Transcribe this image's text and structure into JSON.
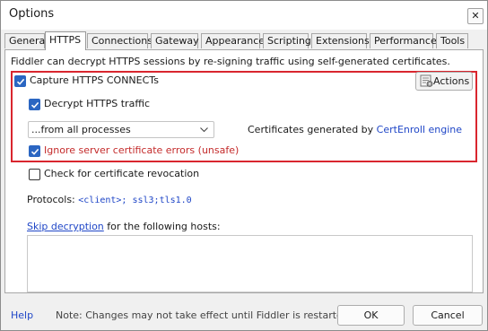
{
  "window": {
    "title": "Options",
    "close_glyph": "✕"
  },
  "tabs": [
    {
      "label": "General",
      "active": false
    },
    {
      "label": "HTTPS",
      "active": true
    },
    {
      "label": "Connections",
      "active": false
    },
    {
      "label": "Gateway",
      "active": false
    },
    {
      "label": "Appearance",
      "active": false
    },
    {
      "label": "Scripting",
      "active": false
    },
    {
      "label": "Extensions",
      "active": false
    },
    {
      "label": "Performance",
      "active": false
    },
    {
      "label": "Tools",
      "active": false
    }
  ],
  "https": {
    "intro": "Fiddler can decrypt HTTPS sessions by re-signing traffic using self-generated certificates.",
    "capture_label": "Capture HTTPS CONNECTs",
    "capture_checked": true,
    "actions_label": "Actions",
    "decrypt_label": "Decrypt HTTPS traffic",
    "decrypt_checked": true,
    "process_filter_value": "...from all processes",
    "cert_prefix": "Certificates generated by ",
    "cert_engine_link": "CertEnroll engine",
    "ignore_errors_label": "Ignore server certificate errors (unsafe)",
    "ignore_errors_checked": true,
    "revocation_label": "Check for certificate revocation",
    "revocation_checked": false,
    "protocols_label": "Protocols: ",
    "protocols_value": "<client>; ssl3;tls1.0",
    "skip_link": "Skip decryption",
    "skip_suffix": " for the following hosts:",
    "skip_hosts_value": ""
  },
  "footer": {
    "help_link": "Help",
    "note": "Note: Changes may not take effect until Fiddler is restarted.",
    "ok_label": "OK",
    "cancel_label": "Cancel"
  },
  "colors": {
    "accent": "#2b66c2",
    "highlight_border": "#d9262e",
    "warning_text": "#c42b2b",
    "link": "#1f46c7"
  }
}
